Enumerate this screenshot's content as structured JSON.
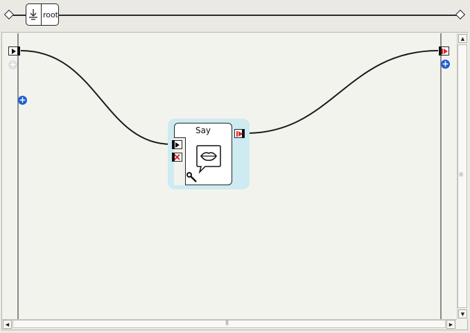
{
  "pathbar": {
    "root_label": "root",
    "root_icon": "diagram-down-arrow-icon"
  },
  "diagram": {
    "box": {
      "title": "Say",
      "icon": "speech-lips-icon",
      "input_ports": [
        "onStart-play-icon",
        "onStop-stop-icon"
      ],
      "output_ports": [
        "onStopped-output-icon"
      ],
      "settings_icon": "wrench-icon"
    },
    "left_rail": {
      "input_port": "onStart-play-icon",
      "add_buttons": [
        "add-input-grey",
        "add-input-blue"
      ]
    },
    "right_rail": {
      "output_port": "onStopped-output-icon",
      "add_buttons": [
        "add-output-blue"
      ]
    }
  },
  "colors": {
    "canvas_bg": "#f3f3ee",
    "box_halo": "#cdebf0",
    "add_button": "#1f5fd1",
    "stop_red": "#d62828"
  }
}
